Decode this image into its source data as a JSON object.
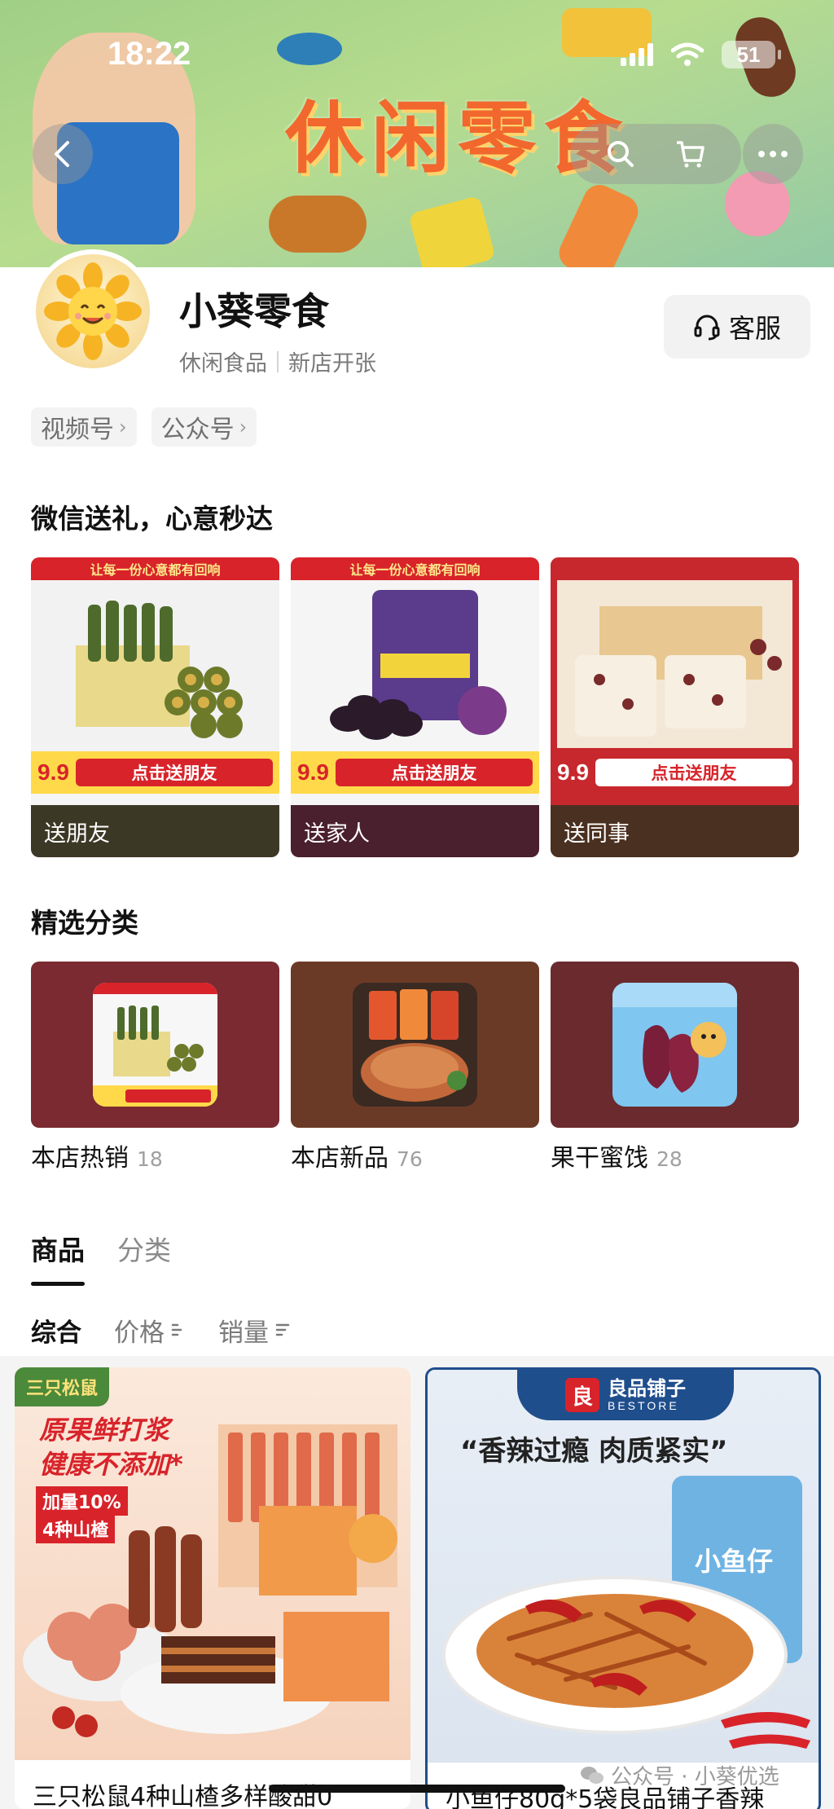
{
  "status_bar": {
    "time": "18:22",
    "battery": "51"
  },
  "banner": {
    "title": "休闲零食"
  },
  "store": {
    "name": "小葵零食",
    "tag_category": "休闲食品",
    "tag_status": "新店开张",
    "service_label": "客服"
  },
  "links": [
    {
      "label": "视频号"
    },
    {
      "label": "公众号"
    }
  ],
  "gift_section": {
    "title": "微信送礼，心意秒达",
    "banner_text": "让每一份心意都有回响",
    "send_tag": "点击送朋友",
    "cards": [
      {
        "caption": "送朋友",
        "price": "9.9",
        "color": "#3c3826"
      },
      {
        "caption": "送家人",
        "price": "9.9",
        "color": "#4a1f2e"
      },
      {
        "caption": "送同事",
        "price": "9.9",
        "color": "#4a3020"
      }
    ]
  },
  "category_section": {
    "title": "精选分类",
    "items": [
      {
        "label": "本店热销",
        "count": "18"
      },
      {
        "label": "本店新品",
        "count": "76"
      },
      {
        "label": "果干蜜饯",
        "count": "28"
      }
    ]
  },
  "tabs": [
    {
      "label": "商品"
    },
    {
      "label": "分类"
    }
  ],
  "sort": [
    {
      "label": "综合"
    },
    {
      "label": "价格"
    },
    {
      "label": "销量"
    }
  ],
  "products": [
    {
      "brand": "三只松鼠",
      "promo1": "原果鲜打浆",
      "promo2": "健康不添加*",
      "promo3": "加量10%",
      "promo4": "4种山楂",
      "title": "三只松鼠4种山楂多样酸甜0"
    },
    {
      "brand": "良品铺子",
      "brand_en": "BESTORE",
      "slogan": "“香辣过瘾 肉质紧实”",
      "pack_label": "小鱼仔",
      "title": "小鱼仔80g*5袋良品铺子香辣"
    }
  ],
  "watermark": "公众号 · 小葵优选"
}
